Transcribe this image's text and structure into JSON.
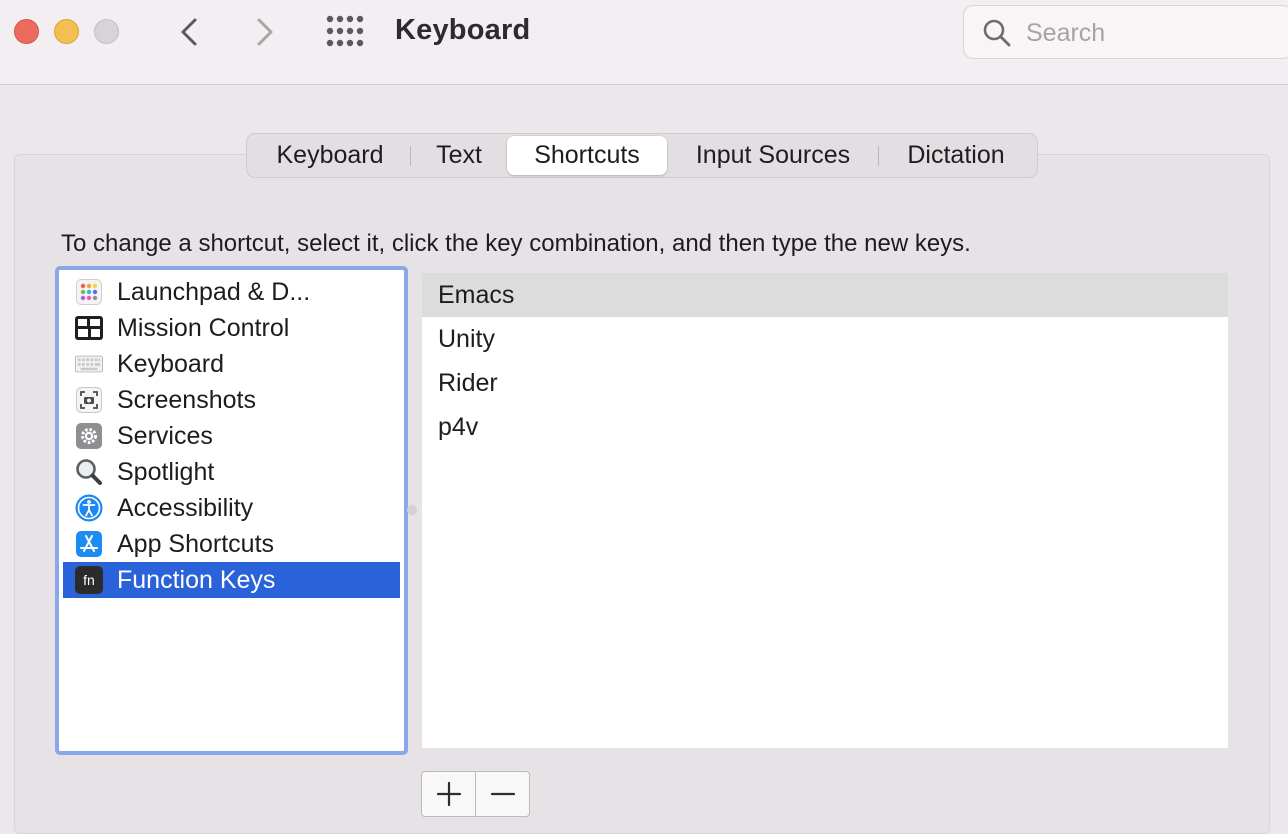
{
  "window": {
    "title": "Keyboard",
    "search_placeholder": "Search"
  },
  "tabs": [
    {
      "label": "Keyboard",
      "active": false
    },
    {
      "label": "Text",
      "active": false
    },
    {
      "label": "Shortcuts",
      "active": true
    },
    {
      "label": "Input Sources",
      "active": false
    },
    {
      "label": "Dictation",
      "active": false
    }
  ],
  "instructions": "To change a shortcut, select it, click the key combination, and then type the new keys.",
  "categories": [
    {
      "label": "Launchpad & D...",
      "icon": "launchpad-icon"
    },
    {
      "label": "Mission Control",
      "icon": "mission-control-icon"
    },
    {
      "label": "Keyboard",
      "icon": "keyboard-icon"
    },
    {
      "label": "Screenshots",
      "icon": "screenshot-icon"
    },
    {
      "label": "Services",
      "icon": "gear-icon"
    },
    {
      "label": "Spotlight",
      "icon": "magnifier-icon"
    },
    {
      "label": "Accessibility",
      "icon": "accessibility-icon"
    },
    {
      "label": "App Shortcuts",
      "icon": "app-store-icon"
    },
    {
      "label": "Function Keys",
      "icon": "fn-icon",
      "selected": true
    }
  ],
  "shortcuts": [
    {
      "label": "Emacs",
      "highlighted": true
    },
    {
      "label": "Unity"
    },
    {
      "label": "Rider"
    },
    {
      "label": "p4v"
    }
  ],
  "colors": {
    "selection": "#2a62d9",
    "focus_ring": "#8aa7ea",
    "close": "#ed6a5e",
    "minimize": "#f5bf4f"
  }
}
